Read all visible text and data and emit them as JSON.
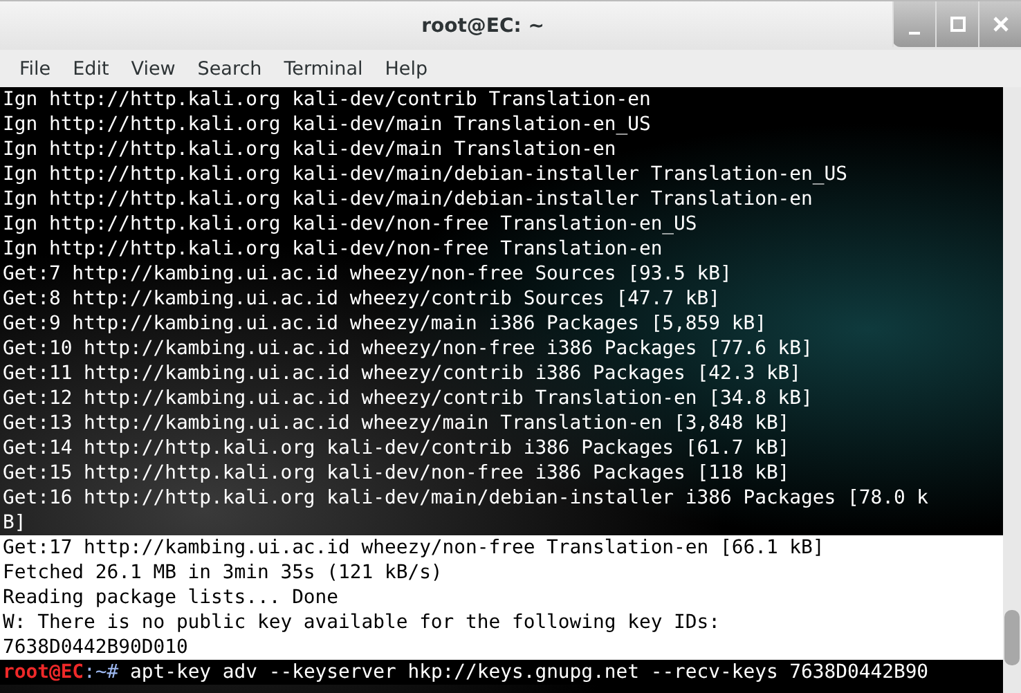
{
  "window": {
    "title": "root@EC: ~"
  },
  "menu": [
    "File",
    "Edit",
    "View",
    "Search",
    "Terminal",
    "Help"
  ],
  "terminal": {
    "lines": [
      {
        "kind": "output",
        "highlighted": false,
        "text": "Ign http://http.kali.org kali-dev/contrib Translation-en"
      },
      {
        "kind": "output",
        "highlighted": false,
        "text": "Ign http://http.kali.org kali-dev/main Translation-en_US"
      },
      {
        "kind": "output",
        "highlighted": false,
        "text": "Ign http://http.kali.org kali-dev/main Translation-en"
      },
      {
        "kind": "output",
        "highlighted": false,
        "text": "Ign http://http.kali.org kali-dev/main/debian-installer Translation-en_US"
      },
      {
        "kind": "output",
        "highlighted": false,
        "text": "Ign http://http.kali.org kali-dev/main/debian-installer Translation-en"
      },
      {
        "kind": "output",
        "highlighted": false,
        "text": "Ign http://http.kali.org kali-dev/non-free Translation-en_US"
      },
      {
        "kind": "output",
        "highlighted": false,
        "text": "Ign http://http.kali.org kali-dev/non-free Translation-en"
      },
      {
        "kind": "output",
        "highlighted": false,
        "text": "Get:7 http://kambing.ui.ac.id wheezy/non-free Sources [93.5 kB]"
      },
      {
        "kind": "output",
        "highlighted": false,
        "text": "Get:8 http://kambing.ui.ac.id wheezy/contrib Sources [47.7 kB]"
      },
      {
        "kind": "output",
        "highlighted": false,
        "text": "Get:9 http://kambing.ui.ac.id wheezy/main i386 Packages [5,859 kB]"
      },
      {
        "kind": "output",
        "highlighted": false,
        "text": "Get:10 http://kambing.ui.ac.id wheezy/non-free i386 Packages [77.6 kB]"
      },
      {
        "kind": "output",
        "highlighted": false,
        "text": "Get:11 http://kambing.ui.ac.id wheezy/contrib i386 Packages [42.3 kB]"
      },
      {
        "kind": "output",
        "highlighted": false,
        "text": "Get:12 http://kambing.ui.ac.id wheezy/contrib Translation-en [34.8 kB]"
      },
      {
        "kind": "output",
        "highlighted": false,
        "text": "Get:13 http://kambing.ui.ac.id wheezy/main Translation-en [3,848 kB]"
      },
      {
        "kind": "output",
        "highlighted": false,
        "text": "Get:14 http://http.kali.org kali-dev/contrib i386 Packages [61.7 kB]"
      },
      {
        "kind": "output",
        "highlighted": false,
        "text": "Get:15 http://http.kali.org kali-dev/non-free i386 Packages [118 kB]"
      },
      {
        "kind": "output",
        "highlighted": false,
        "text": "Get:16 http://http.kali.org kali-dev/main/debian-installer i386 Packages [78.0 k"
      },
      {
        "kind": "output",
        "highlighted": false,
        "text": "B]"
      },
      {
        "kind": "output",
        "highlighted": true,
        "text": "Get:17 http://kambing.ui.ac.id wheezy/non-free Translation-en [66.1 kB]"
      },
      {
        "kind": "output",
        "highlighted": true,
        "text": "Fetched 26.1 MB in 3min 35s (121 kB/s)"
      },
      {
        "kind": "output",
        "highlighted": true,
        "text": "Reading package lists... Done"
      },
      {
        "kind": "output",
        "highlighted": true,
        "text": "W: There is no public key available for the following key IDs:"
      },
      {
        "kind": "output",
        "highlighted": true,
        "text": "7638D0442B90D010"
      },
      {
        "kind": "prompt",
        "highlighted": false,
        "user": "root@EC",
        "path": ":~#",
        "text": "apt-key adv --keyserver hkp://keys.gnupg.net --recv-keys 7638D0442B90"
      }
    ]
  }
}
